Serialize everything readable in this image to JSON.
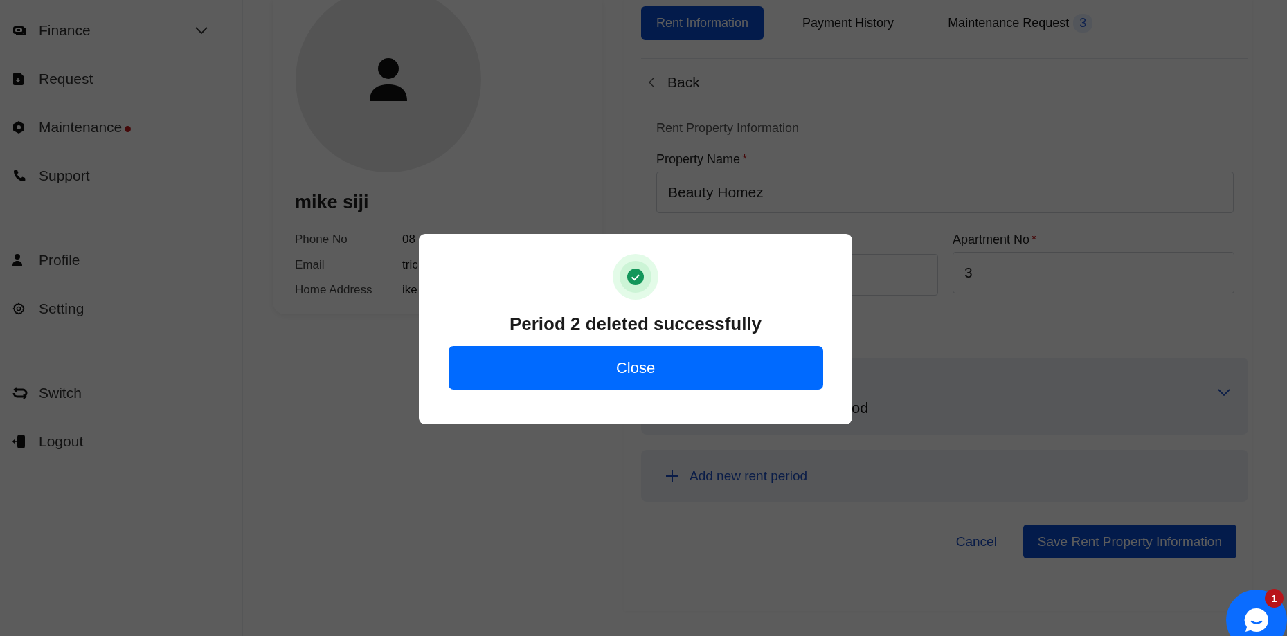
{
  "sidebar": {
    "groups": [
      {
        "items": [
          {
            "label": "Finance",
            "has_submenu": true,
            "alert": false
          },
          {
            "label": "Request",
            "has_submenu": false,
            "alert": false
          },
          {
            "label": "Maintenance",
            "has_submenu": false,
            "alert": true
          },
          {
            "label": "Support",
            "has_submenu": false,
            "alert": false
          }
        ]
      },
      {
        "items": [
          {
            "label": "Profile",
            "has_submenu": false,
            "alert": false
          },
          {
            "label": "Setting",
            "has_submenu": false,
            "alert": false
          }
        ]
      },
      {
        "items": [
          {
            "label": "Switch",
            "has_submenu": false,
            "alert": false
          },
          {
            "label": "Logout",
            "has_submenu": false,
            "alert": false
          }
        ]
      }
    ]
  },
  "profile": {
    "name": "mike siji",
    "fields": [
      {
        "label": "Phone No",
        "value": "08"
      },
      {
        "label": "Email",
        "value": "tric"
      },
      {
        "label": "Home Address",
        "value": "ike"
      }
    ]
  },
  "tabs": [
    {
      "label": "Rent Information",
      "selected": true
    },
    {
      "label": "Payment History",
      "selected": false
    },
    {
      "label": "Maintenance Request",
      "selected": false,
      "badge": "3"
    }
  ],
  "back": "Back",
  "form": {
    "section_title": "Rent Property Information",
    "property_name": {
      "label": "Property Name",
      "mark": "*",
      "value": "Beauty Homez"
    },
    "apartment": {
      "label": "Apartment No",
      "mark": "*",
      "value": "3"
    },
    "rent_period": {
      "title": "od",
      "expanded": false
    },
    "add_period": "Add new rent period",
    "cancel": "Cancel",
    "save": "Save Rent Property Information"
  },
  "modal": {
    "message": "Period 2 deleted successfully",
    "button": "Close"
  },
  "chat": {
    "badge": "1"
  }
}
